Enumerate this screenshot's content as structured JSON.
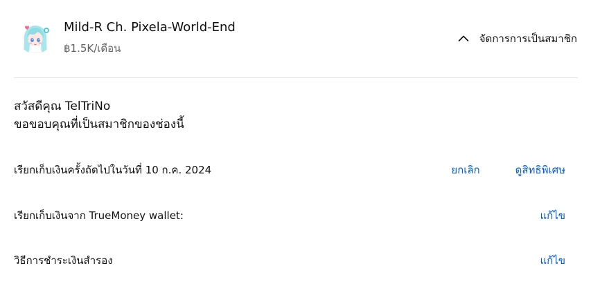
{
  "header": {
    "channel_name": "Mild-R Ch. Pixela-World-End",
    "price": "฿1.5K/เดือน",
    "manage_label": "จัดการการเป็นสมาชิก"
  },
  "greeting": {
    "line1": "สวัสดีคุณ TelTriNo",
    "line2": "ขอขอบคุณที่เป็นสมาชิกของช่องนี้"
  },
  "billing": {
    "next_charge_label": "เรียกเก็บเงินครั้งถัดไปในวันที่ 10 ก.ค. 2024",
    "cancel_label": "ยกเลิก",
    "view_perks_label": "ดูสิทธิพิเศษ"
  },
  "payment": {
    "method_label": "เรียกเก็บเงินจาก TrueMoney wallet:",
    "edit_label": "แก้ไข"
  },
  "backup": {
    "label": "วิธีการชำระเงินสำรอง",
    "edit_label": "แก้ไข"
  },
  "colors": {
    "link": "#065fd4",
    "text": "#0f0f0f",
    "secondary": "#606060",
    "divider": "#e5e5e5"
  },
  "icons": {
    "manage": "chevron-up-icon",
    "avatar": "channel-avatar"
  }
}
